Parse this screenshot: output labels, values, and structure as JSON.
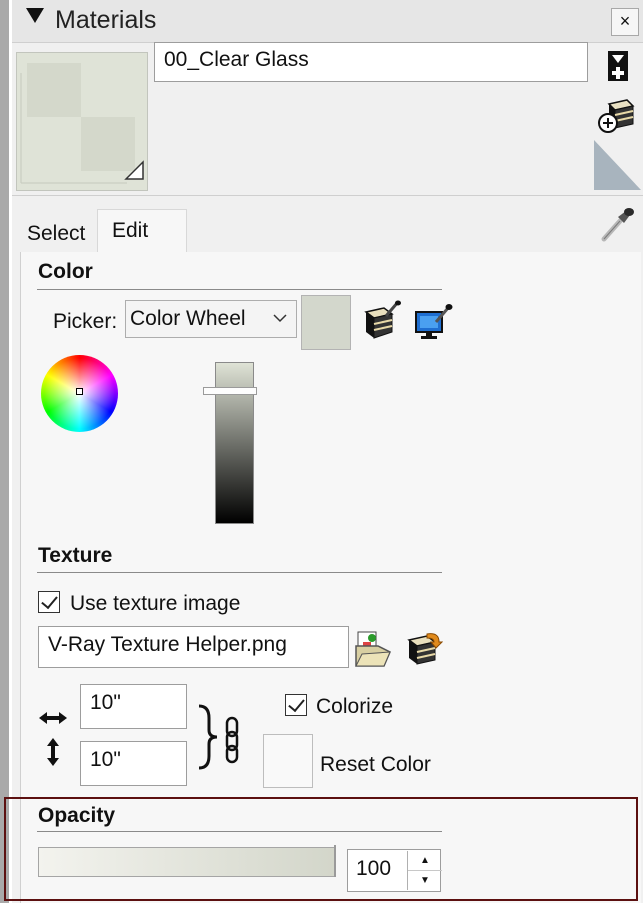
{
  "panel": {
    "title": "Materials",
    "close_symbol": "×"
  },
  "material": {
    "name": "00_Clear Glass"
  },
  "tabs": [
    {
      "label": "Select",
      "active": false
    },
    {
      "label": "Edit",
      "active": true
    }
  ],
  "color": {
    "section_title": "Color",
    "picker_label": "Picker:",
    "picker_value": "Color Wheel",
    "swatch_color": "#d3d7cc"
  },
  "texture": {
    "section_title": "Texture",
    "use_texture_label": "Use texture image",
    "use_texture_checked": true,
    "file_name": "V-Ray Texture Helper.png",
    "width": "10\"",
    "height": "10\"",
    "colorize_label": "Colorize",
    "colorize_checked": true,
    "reset_color_label": "Reset Color"
  },
  "opacity": {
    "section_title": "Opacity",
    "value": "100"
  },
  "icons": {
    "title_collapse": "triangle-down-icon",
    "create_material": "create-material-icon",
    "details": "details-arrow-icon",
    "sample_paint": "eyedropper-icon",
    "match_model_color": "match-model-color-icon",
    "match_screen_color": "match-screen-color-icon",
    "browse_texture": "folder-open-icon",
    "edit_texture": "edit-texture-icon",
    "width_arrows": "horizontal-arrows-icon",
    "height_arrows": "vertical-arrows-icon",
    "aspect_lock": "chain-link-icon"
  },
  "colors": {
    "highlight_frame": "#5c1010",
    "material_tint": "#d3d7cc"
  }
}
